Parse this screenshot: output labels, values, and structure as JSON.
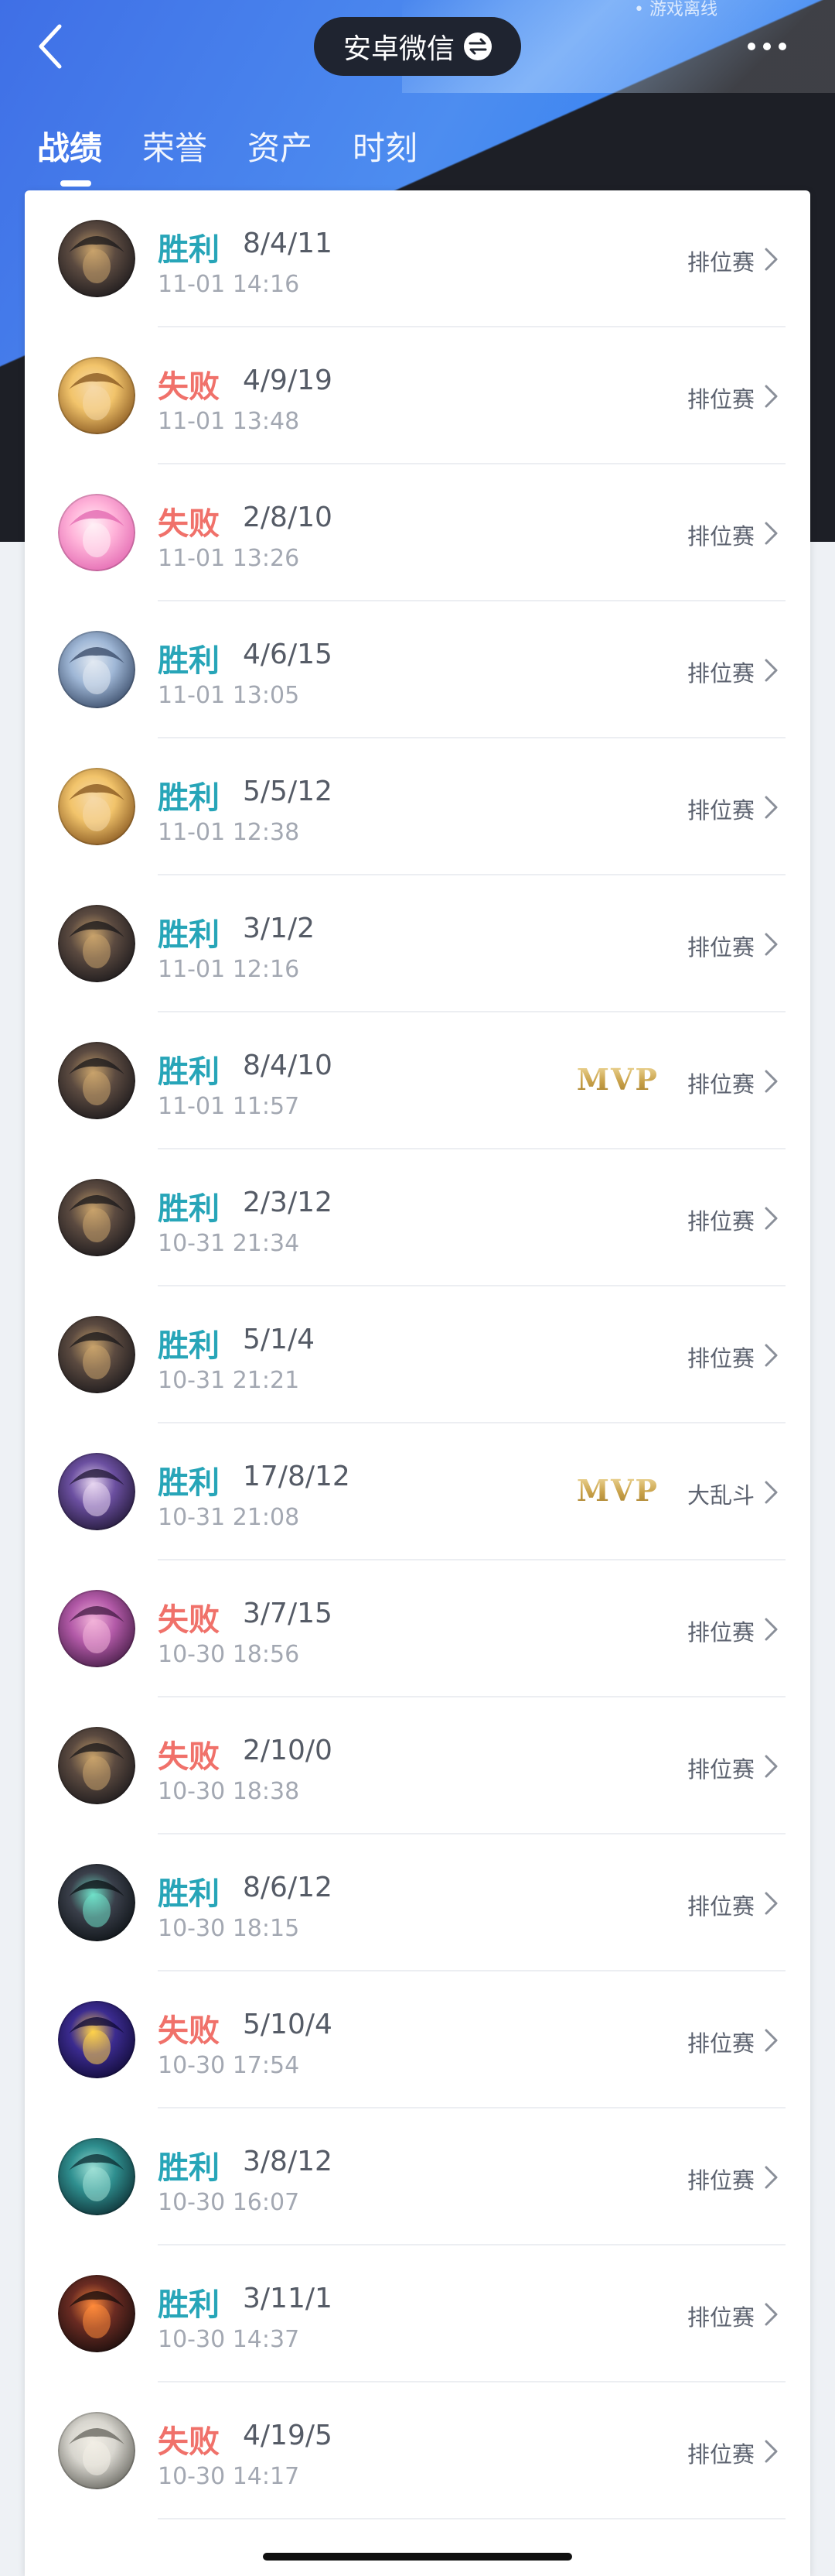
{
  "header": {
    "account_label": "安卓微信",
    "top_right_hint": "• 游戏离线",
    "tabs": [
      "战绩",
      "荣誉",
      "资产",
      "时刻"
    ],
    "active_tab": 0
  },
  "colors": {
    "win": "#27a5b8",
    "loss": "#f0716a",
    "pill": "#1f2430"
  },
  "matches": [
    {
      "result": "胜利",
      "outcome": "win",
      "kda": "8/4/11",
      "time": "11-01 14:16",
      "mode": "排位赛",
      "mvp": "",
      "avatar": "hero-dark-hat-icon"
    },
    {
      "result": "失败",
      "outcome": "loss",
      "kda": "4/9/19",
      "time": "11-01 13:48",
      "mode": "排位赛",
      "mvp": "",
      "avatar": "hero-golden-girl-icon"
    },
    {
      "result": "失败",
      "outcome": "loss",
      "kda": "2/8/10",
      "time": "11-01 13:26",
      "mode": "排位赛",
      "mvp": "",
      "avatar": "hero-pink-girl-icon"
    },
    {
      "result": "胜利",
      "outcome": "win",
      "kda": "4/6/15",
      "time": "11-01 13:05",
      "mode": "排位赛",
      "mvp": "",
      "avatar": "hero-armored-icon"
    },
    {
      "result": "胜利",
      "outcome": "win",
      "kda": "5/5/12",
      "time": "11-01 12:38",
      "mode": "排位赛",
      "mvp": "",
      "avatar": "hero-golden-girl-icon"
    },
    {
      "result": "胜利",
      "outcome": "win",
      "kda": "3/1/2",
      "time": "11-01 12:16",
      "mode": "排位赛",
      "mvp": "",
      "avatar": "hero-dark-hat-icon"
    },
    {
      "result": "胜利",
      "outcome": "win",
      "kda": "8/4/10",
      "time": "11-01 11:57",
      "mode": "排位赛",
      "mvp": "MVP",
      "avatar": "hero-dark-hat-icon"
    },
    {
      "result": "胜利",
      "outcome": "win",
      "kda": "2/3/12",
      "time": "10-31 21:34",
      "mode": "排位赛",
      "mvp": "",
      "avatar": "hero-dark-hat-icon"
    },
    {
      "result": "胜利",
      "outcome": "win",
      "kda": "5/1/4",
      "time": "10-31 21:21",
      "mode": "排位赛",
      "mvp": "",
      "avatar": "hero-dark-hat-icon"
    },
    {
      "result": "胜利",
      "outcome": "win",
      "kda": "17/8/12",
      "time": "10-31 21:08",
      "mode": "大乱斗",
      "mvp": "MVP",
      "avatar": "hero-purple-hair-icon"
    },
    {
      "result": "失败",
      "outcome": "loss",
      "kda": "3/7/15",
      "time": "10-30 18:56",
      "mode": "排位赛",
      "mvp": "",
      "avatar": "hero-purple-imp-icon"
    },
    {
      "result": "失败",
      "outcome": "loss",
      "kda": "2/10/0",
      "time": "10-30 18:38",
      "mode": "排位赛",
      "mvp": "",
      "avatar": "hero-dark-hat-icon"
    },
    {
      "result": "胜利",
      "outcome": "win",
      "kda": "8/6/12",
      "time": "10-30 18:15",
      "mode": "排位赛",
      "mvp": "",
      "avatar": "hero-yordle-mage-icon"
    },
    {
      "result": "失败",
      "outcome": "loss",
      "kda": "5/10/4",
      "time": "10-30 17:54",
      "mode": "排位赛",
      "mvp": "",
      "avatar": "hero-void-mage-icon"
    },
    {
      "result": "胜利",
      "outcome": "win",
      "kda": "3/8/12",
      "time": "10-30 16:07",
      "mode": "排位赛",
      "mvp": "",
      "avatar": "hero-teal-warrior-icon"
    },
    {
      "result": "胜利",
      "outcome": "win",
      "kda": "3/11/1",
      "time": "10-30 14:37",
      "mode": "排位赛",
      "mvp": "",
      "avatar": "hero-red-armor-icon"
    },
    {
      "result": "失败",
      "outcome": "loss",
      "kda": "4/19/5",
      "time": "10-30 14:17",
      "mode": "排位赛",
      "mvp": "",
      "avatar": "hero-white-hair-icon"
    }
  ]
}
